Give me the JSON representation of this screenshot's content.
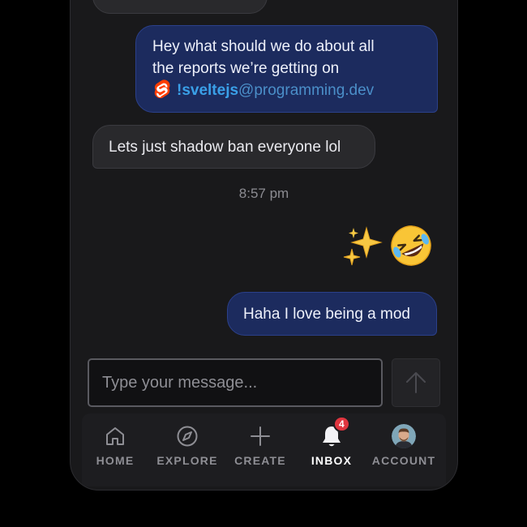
{
  "messages": [
    {
      "direction": "out",
      "line1": "Hey what should we do about all",
      "line2": "the reports we’re getting on",
      "community": "!sveltejs",
      "instance": "@programming.dev",
      "community_icon": "svelte-logo-icon"
    },
    {
      "direction": "in",
      "text": "Lets just shadow ban everyone lol"
    },
    {
      "direction": "out",
      "text": "Haha I love being a mod"
    }
  ],
  "timestamp": "8:57 pm",
  "emoji_reaction": [
    "✨",
    "🤣"
  ],
  "composer": {
    "placeholder": "Type your message...",
    "value": ""
  },
  "send_icon": "arrow-up-icon",
  "nav": {
    "items": [
      {
        "label": "HOME",
        "icon": "home-icon"
      },
      {
        "label": "EXPLORE",
        "icon": "compass-icon"
      },
      {
        "label": "CREATE",
        "icon": "plus-icon"
      },
      {
        "label": "INBOX",
        "icon": "bell-icon",
        "badge": "4",
        "active": true
      },
      {
        "label": "ACCOUNT",
        "icon": "avatar"
      }
    ]
  },
  "colors": {
    "background": "#19191b",
    "incoming_bubble": "#29292c",
    "outgoing_bubble": "#1c2b5e",
    "badge": "#e0353f",
    "link": "#3aa0e8"
  }
}
